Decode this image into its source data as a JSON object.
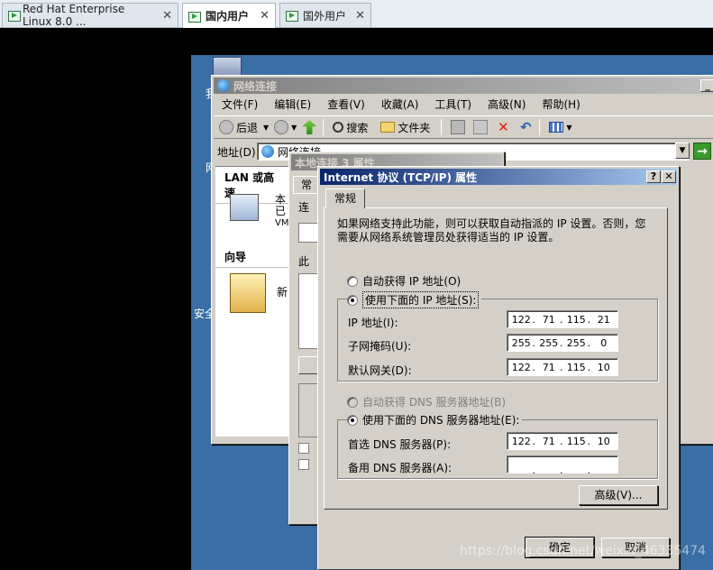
{
  "host_tabs": [
    {
      "label": "Red Hat Enterprise Linux 8.0 ..."
    },
    {
      "label": "国内用户"
    },
    {
      "label": "国外用户"
    }
  ],
  "desktop": {
    "icon_caption_1": "我",
    "icon_caption_2": "网",
    "icon_caption_3": "安全"
  },
  "explorer": {
    "title": "网络连接",
    "menu": [
      "文件(F)",
      "编辑(E)",
      "查看(V)",
      "收藏(A)",
      "工具(T)",
      "高级(N)",
      "帮助(H)"
    ],
    "back_label": "后退",
    "search_label": "搜索",
    "folders_label": "文件夹",
    "address_label": "地址(D)",
    "address_value": "网络连接",
    "section_lan": "LAN 或高速",
    "conn_name_1": "本",
    "conn_name_2": "已",
    "conn_name_3": "VM",
    "section_wizard": "向导",
    "wizard_item": "新"
  },
  "local_conn": {
    "title": "本地连接 3 属性",
    "tab_label": "常",
    "frag_1": "连",
    "frag_2": "此"
  },
  "tcpip": {
    "title": "Internet 协议 (TCP/IP) 属性",
    "tab": "常规",
    "description": "如果网络支持此功能，则可以获取自动指派的 IP 设置。否则，您需要从网络系统管理员处获得适当的 IP 设置。",
    "auto_ip": "自动获得 IP 地址(O)",
    "manual_ip": "使用下面的 IP 地址(S):",
    "ip_label": "IP 地址(I):",
    "ip_octets": [
      "122",
      "71",
      "115",
      "21"
    ],
    "mask_label": "子网掩码(U):",
    "mask_octets": [
      "255",
      "255",
      "255",
      "0"
    ],
    "gateway_label": "默认网关(D):",
    "gateway_octets": [
      "122",
      "71",
      "115",
      "10"
    ],
    "auto_dns": "自动获得 DNS 服务器地址(B)",
    "manual_dns": "使用下面的 DNS 服务器地址(E):",
    "pref_dns_label": "首选 DNS 服务器(P):",
    "pref_dns_octets": [
      "122",
      "71",
      "115",
      "10"
    ],
    "alt_dns_label": "备用 DNS 服务器(A):",
    "alt_dns_octets": [
      "",
      "",
      "",
      ""
    ],
    "advanced_button": "高级(V)...",
    "ok_button": "确定",
    "cancel_button": "取消"
  },
  "watermark": "https://blog.csdn.net/weixin_46335474"
}
